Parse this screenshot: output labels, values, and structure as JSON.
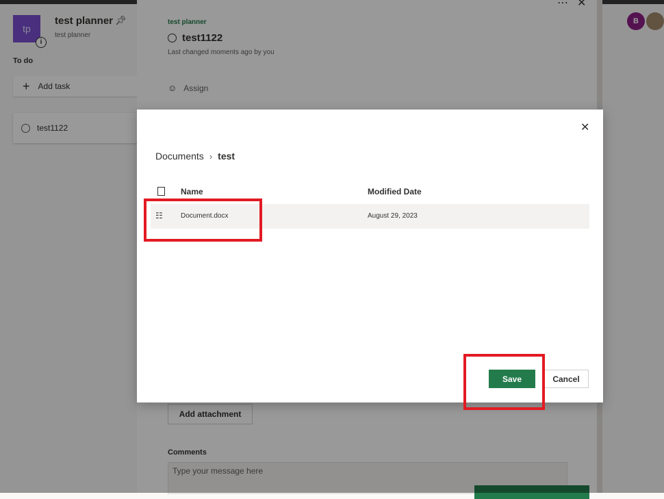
{
  "plan": {
    "initials": "tp",
    "title": "test planner",
    "subtitle": "test planner",
    "bucket_label": "To do",
    "add_task_label": "Add task",
    "task_name": "test1122"
  },
  "header": {
    "user_initial": "B"
  },
  "task_details": {
    "plan_name": "test planner",
    "task_title": "test1122",
    "last_changed": "Last changed moments ago by you",
    "assign_label": "Assign",
    "add_attachment_label": "Add attachment",
    "comments_label": "Comments",
    "comment_placeholder": "Type your message here"
  },
  "dialog": {
    "breadcrumb": [
      "Documents",
      "test"
    ],
    "columns": {
      "name": "Name",
      "modified": "Modified Date"
    },
    "files": [
      {
        "name": "Document.docx",
        "modified": "August 29, 2023"
      }
    ],
    "save_label": "Save",
    "cancel_label": "Cancel"
  },
  "colors": {
    "accent": "#237b4b",
    "plan_tile": "#7a4fd1",
    "highlight": "#e21a23"
  }
}
